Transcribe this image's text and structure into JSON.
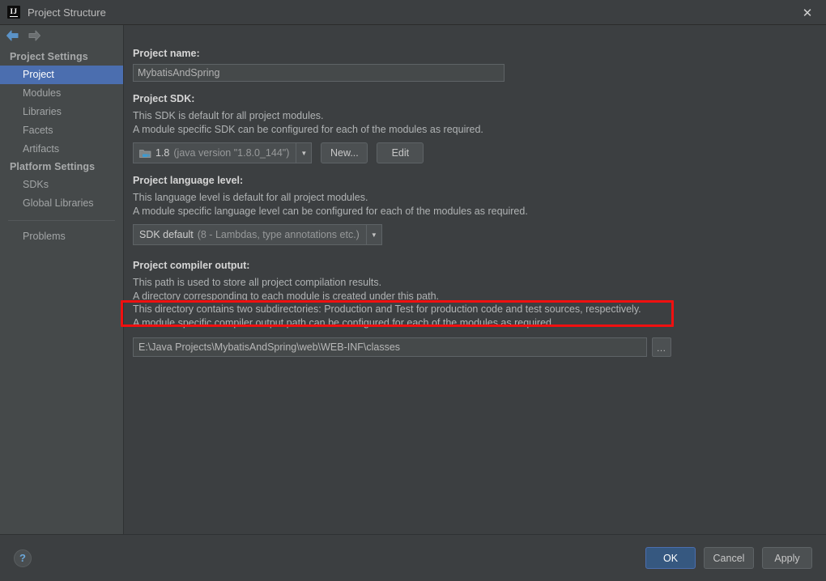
{
  "window": {
    "title": "Project Structure",
    "app_icon": "intellij-idea-icon",
    "close_label": "✕"
  },
  "nav": {
    "back_icon": "arrow-left-icon",
    "forward_icon": "arrow-right-icon"
  },
  "sidebar": {
    "groups": [
      {
        "header": "Project Settings",
        "items": [
          {
            "label": "Project",
            "selected": true
          },
          {
            "label": "Modules",
            "selected": false
          },
          {
            "label": "Libraries",
            "selected": false
          },
          {
            "label": "Facets",
            "selected": false
          },
          {
            "label": "Artifacts",
            "selected": false
          }
        ]
      },
      {
        "header": "Platform Settings",
        "items": [
          {
            "label": "SDKs",
            "selected": false
          },
          {
            "label": "Global Libraries",
            "selected": false
          }
        ]
      }
    ],
    "extra_items": [
      {
        "label": "Problems",
        "selected": false
      }
    ]
  },
  "main": {
    "project_name": {
      "label": "Project name:",
      "value": "MybatisAndSpring"
    },
    "project_sdk": {
      "label": "Project SDK:",
      "desc1": "This SDK is default for all project modules.",
      "desc2": "A module specific SDK can be configured for each of the modules as required.",
      "selected_version": "1.8",
      "selected_detail": "(java version \"1.8.0_144\")",
      "icon": "java-sdk-folder-icon",
      "dropdown_arrow": "▼",
      "new_button": "New...",
      "edit_button": "Edit"
    },
    "language_level": {
      "label": "Project language level:",
      "desc1": "This language level is default for all project modules.",
      "desc2": "A module specific language level can be configured for each of the modules as required.",
      "selected_primary": "SDK default",
      "selected_detail": "(8 - Lambdas, type annotations etc.)",
      "dropdown_arrow": "▼"
    },
    "compiler_output": {
      "label": "Project compiler output:",
      "desc1": "This path is used to store all project compilation results.",
      "desc2": "A directory corresponding to each module is created under this path.",
      "desc3": "This directory contains two subdirectories: Production and Test for production code and test sources, respectively.",
      "desc4": "A module specific compiler output path can be configured for each of the modules as required.",
      "path_value": "E:\\Java Projects\\MybatisAndSpring\\web\\WEB-INF\\classes",
      "browse_button": "…",
      "highlight_color": "#f01010"
    }
  },
  "footer": {
    "help_label": "?",
    "ok_label": "OK",
    "cancel_label": "Cancel",
    "apply_label": "Apply"
  },
  "colors": {
    "window_bg": "#3c3f41",
    "sidebar_bg": "#45494a",
    "selection_blue": "#4b6eaf",
    "default_button_blue": "#365880",
    "annotation_red": "#f01010"
  }
}
